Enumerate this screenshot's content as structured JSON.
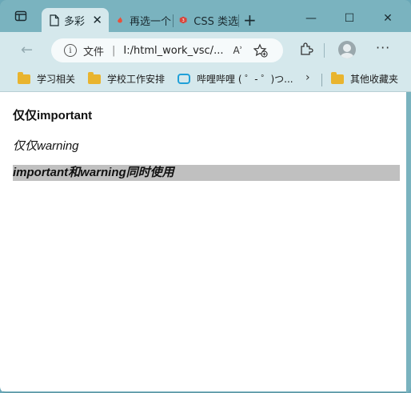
{
  "tabs": [
    {
      "label": "多彩",
      "close": "✕"
    },
    {
      "label": "再选一个"
    },
    {
      "label": "CSS 类选"
    }
  ],
  "new_tab_symbol": "+",
  "window_controls": {
    "minimize": "—",
    "maximize": "☐",
    "close": "✕"
  },
  "address_bar": {
    "info_symbol": "i",
    "site_label": "文件",
    "url": "I:/html_work_vsc/..."
  },
  "read_aloud_label": "Aʾ",
  "favorites_bar": {
    "items": [
      {
        "label": "学习相关",
        "icon": "folder-icon"
      },
      {
        "label": "学校工作安排",
        "icon": "folder-icon"
      },
      {
        "label": "哔哩哔哩 ( ゜- ゜)つ...",
        "icon": "bilibili-icon"
      }
    ],
    "overflow": "›",
    "other_favorites": "其他收藏夹"
  },
  "content": {
    "line1": "仅仅important",
    "line2": "仅仅warning",
    "line3": "important和warning同时使用"
  },
  "colors": {
    "frame": "#7ab3bf",
    "toolbar": "#d5e8ec",
    "highlight": "#c0c0c0",
    "folder": "#e9b42e"
  }
}
